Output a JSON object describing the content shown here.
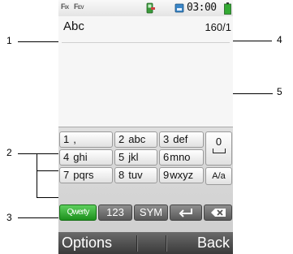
{
  "callouts": [
    "1",
    "2",
    "3",
    "4",
    "5"
  ],
  "status_bar": {
    "signal1": "F",
    "signal1_sub": "IX",
    "signal2": "F",
    "signal2_sub": "EV",
    "time": "03:00"
  },
  "editor": {
    "input_mode": "Abc",
    "char_counter": "160/1"
  },
  "keypad": {
    "rows": [
      [
        {
          "digit": "1",
          "letters": ","
        },
        {
          "digit": "2",
          "letters": "abc"
        },
        {
          "digit": "3",
          "letters": "def"
        }
      ],
      [
        {
          "digit": "4",
          "letters": "ghi"
        },
        {
          "digit": "5",
          "letters": "jkl"
        },
        {
          "digit": "6",
          "letters": "mno"
        }
      ],
      [
        {
          "digit": "7",
          "letters": "pqrs"
        },
        {
          "digit": "8",
          "letters": "tuv"
        },
        {
          "digit": "9",
          "letters": "wxyz"
        }
      ]
    ],
    "zero_label": "0",
    "case_label": "A/a"
  },
  "bottom_row": {
    "qwerty_label": "Qwerty",
    "numeric_label": "123",
    "symbol_label": "SYM"
  },
  "softkeys": {
    "left_label": "Options",
    "right_label": "Back"
  },
  "colors": {
    "qwerty_active": "#2fae2f",
    "softkey_bar": "#4a4a4a",
    "battery": "#33aa33"
  }
}
